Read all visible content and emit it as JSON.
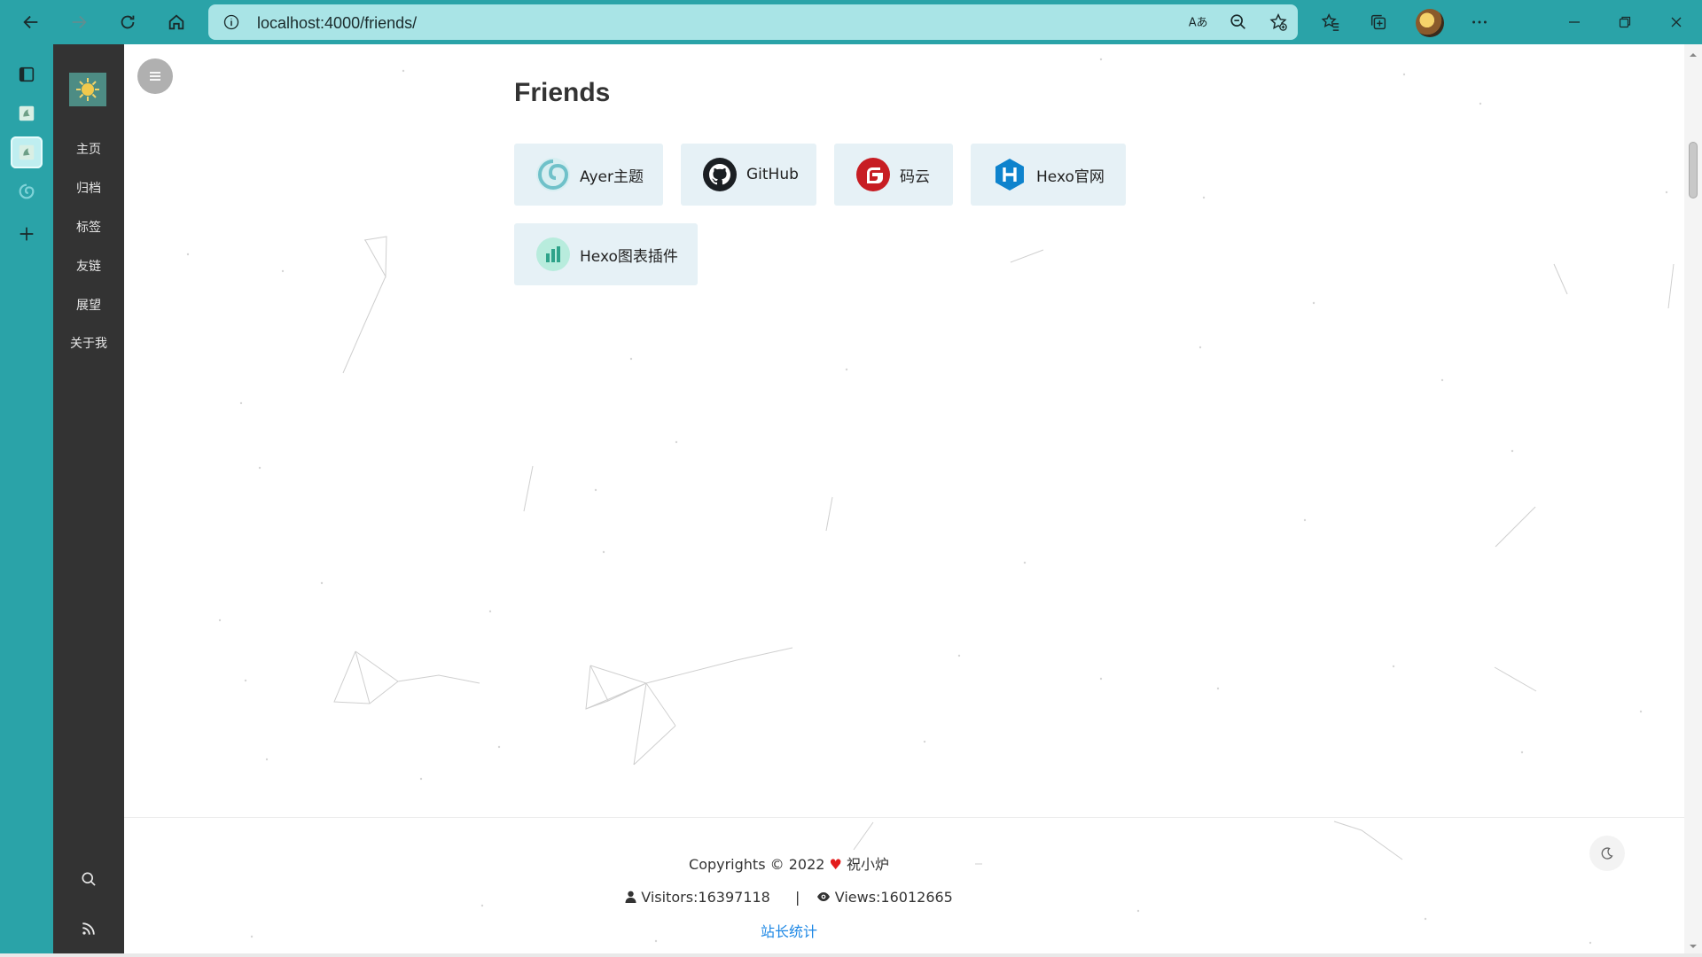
{
  "browser": {
    "url": "localhost:4000/friends/"
  },
  "sidebar": {
    "items": [
      {
        "label": "主页"
      },
      {
        "label": "归档"
      },
      {
        "label": "标签"
      },
      {
        "label": "友链"
      },
      {
        "label": "展望"
      },
      {
        "label": "关于我"
      }
    ]
  },
  "main": {
    "title": "Friends",
    "friends": [
      {
        "name": "Ayer主题",
        "icon": "ayer-swirl-icon"
      },
      {
        "name": "GitHub",
        "icon": "github-icon"
      },
      {
        "name": "码云",
        "icon": "gitee-icon"
      },
      {
        "name": "Hexo官网",
        "icon": "hexo-icon"
      },
      {
        "name": "Hexo图表插件",
        "icon": "chart-plugin-icon"
      }
    ]
  },
  "footer": {
    "copyright_prefix": "Copyrights © 2022",
    "author": "祝小炉",
    "visitors": "Visitors:16397118",
    "separator": "|",
    "views": "Views:16012665",
    "stats_link": "站长统计"
  },
  "colors": {
    "chrome": "#2aa3a8",
    "address_bar": "#a9e4e6",
    "sidebar": "#333333",
    "card": "#e6f1f6",
    "link": "#1e88e5",
    "heart": "#e31b1b"
  }
}
